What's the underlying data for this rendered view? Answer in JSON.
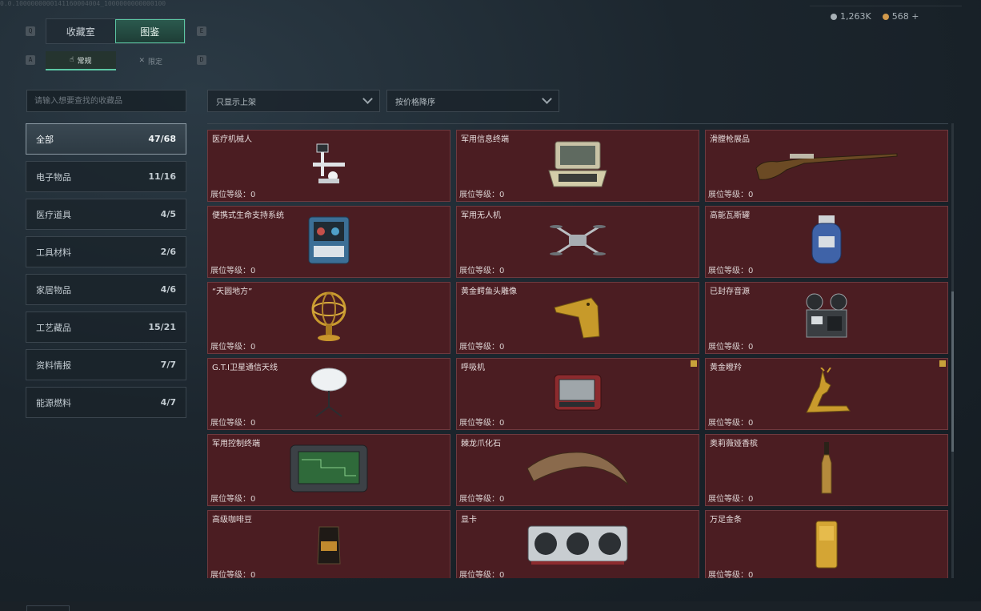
{
  "topline": "0.0.1000000000141160004004_1000000000000100",
  "key_hints": {
    "q": "Q",
    "e": "E",
    "a": "A",
    "d": "D"
  },
  "tabs": [
    {
      "label": "收藏室"
    },
    {
      "label": "图鉴"
    }
  ],
  "sub_tabs": [
    {
      "label": "常规",
      "icon": "hand-icon"
    },
    {
      "label": "限定",
      "icon": "cross-icon"
    }
  ],
  "currency": [
    {
      "value": "1,263K",
      "icon": "silver-coin-icon",
      "color": "#a7b0b6"
    },
    {
      "value": "568",
      "icon": "gold-coin-icon",
      "color": "#d29a4c"
    }
  ],
  "currency_add": "+",
  "search": {
    "placeholder": "请输入想要查找的收藏品"
  },
  "filters": {
    "shelf": "只显示上架",
    "sort": "按价格降序"
  },
  "categories": [
    {
      "label": "全部",
      "count": "47/68"
    },
    {
      "label": "电子物品",
      "count": "11/16"
    },
    {
      "label": "医疗道具",
      "count": "4/5"
    },
    {
      "label": "工具材料",
      "count": "2/6"
    },
    {
      "label": "家居物品",
      "count": "4/6"
    },
    {
      "label": "工艺藏品",
      "count": "15/21"
    },
    {
      "label": "资料情报",
      "count": "7/7"
    },
    {
      "label": "能源燃料",
      "count": "4/7"
    }
  ],
  "items": [
    {
      "name": "医疗机械人",
      "level": "展位等级：0",
      "icon": "medical-robot-icon"
    },
    {
      "name": "军用信息终端",
      "level": "展位等级：0",
      "icon": "military-terminal-icon"
    },
    {
      "name": "滑膛枪展品",
      "level": "展位等级：0",
      "icon": "musket-icon"
    },
    {
      "name": "便携式生命支持系统",
      "level": "展位等级：0",
      "icon": "life-support-icon"
    },
    {
      "name": "军用无人机",
      "level": "展位等级：0",
      "icon": "drone-icon"
    },
    {
      "name": "高能瓦斯罐",
      "level": "展位等级：0",
      "icon": "gas-tank-icon"
    },
    {
      "name": "“天圆地方”",
      "level": "展位等级：0",
      "icon": "armillary-sphere-icon"
    },
    {
      "name": "黄金鳄鱼头雕像",
      "level": "展位等级：0",
      "icon": "gold-crocodile-icon"
    },
    {
      "name": "已封存音源",
      "level": "展位等级：0",
      "icon": "tape-recorder-icon"
    },
    {
      "name": "G.T.I卫星通信天线",
      "level": "展位等级：0",
      "icon": "satellite-dish-icon"
    },
    {
      "name": "呼吸机",
      "level": "展位等级：0",
      "icon": "ventilator-icon"
    },
    {
      "name": "黄金瞪羚",
      "level": "展位等级：0",
      "icon": "gold-gazelle-icon"
    },
    {
      "name": "军用控制终端",
      "level": "展位等级：0",
      "icon": "control-terminal-icon"
    },
    {
      "name": "棘龙爪化石",
      "level": "展位等级：0",
      "icon": "claw-fossil-icon"
    },
    {
      "name": "奥莉薇娅香槟",
      "level": "展位等级：0",
      "icon": "champagne-icon"
    },
    {
      "name": "高级咖啡豆",
      "level": "展位等级：0",
      "icon": "coffee-bag-icon"
    },
    {
      "name": "显卡",
      "level": "展位等级：0",
      "icon": "graphics-card-icon"
    },
    {
      "name": "万足金条",
      "level": "展位等级：0",
      "icon": "gold-bar-icon"
    }
  ]
}
